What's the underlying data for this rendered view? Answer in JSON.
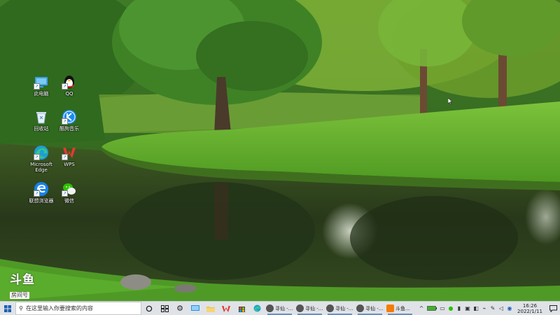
{
  "desktop": {
    "icons": [
      {
        "label": "此电脑",
        "icon": "this-pc-icon"
      },
      {
        "label": "QQ",
        "icon": "qq-penguin-icon"
      },
      {
        "label": "回收站",
        "icon": "recycle-bin-icon"
      },
      {
        "label": "酷狗音乐",
        "icon": "kugou-music-icon"
      },
      {
        "label": "Microsoft Edge",
        "icon": "edge-icon"
      },
      {
        "label": "WPS",
        "icon": "wps-icon"
      },
      {
        "label": "联想浏览器",
        "icon": "lenovo-browser-icon"
      },
      {
        "label": "微信",
        "icon": "wechat-icon"
      }
    ]
  },
  "watermark": {
    "logo": "斗鱼",
    "room": "房间号"
  },
  "taskbar": {
    "search_placeholder": "在这里输入你要搜索的内容",
    "tasks": [
      {
        "label": "寻仙 -..."
      },
      {
        "label": "寻仙 -..."
      },
      {
        "label": "寻仙 -..."
      },
      {
        "label": "寻仙 -..."
      },
      {
        "label": "斗鱼..."
      }
    ],
    "clock_time": "16:26",
    "clock_date": "2022/1/11"
  },
  "colors": {
    "taskbar_bg": "#dfe3e8",
    "grass": "#5fa62a",
    "water": "#2c3f1d"
  }
}
